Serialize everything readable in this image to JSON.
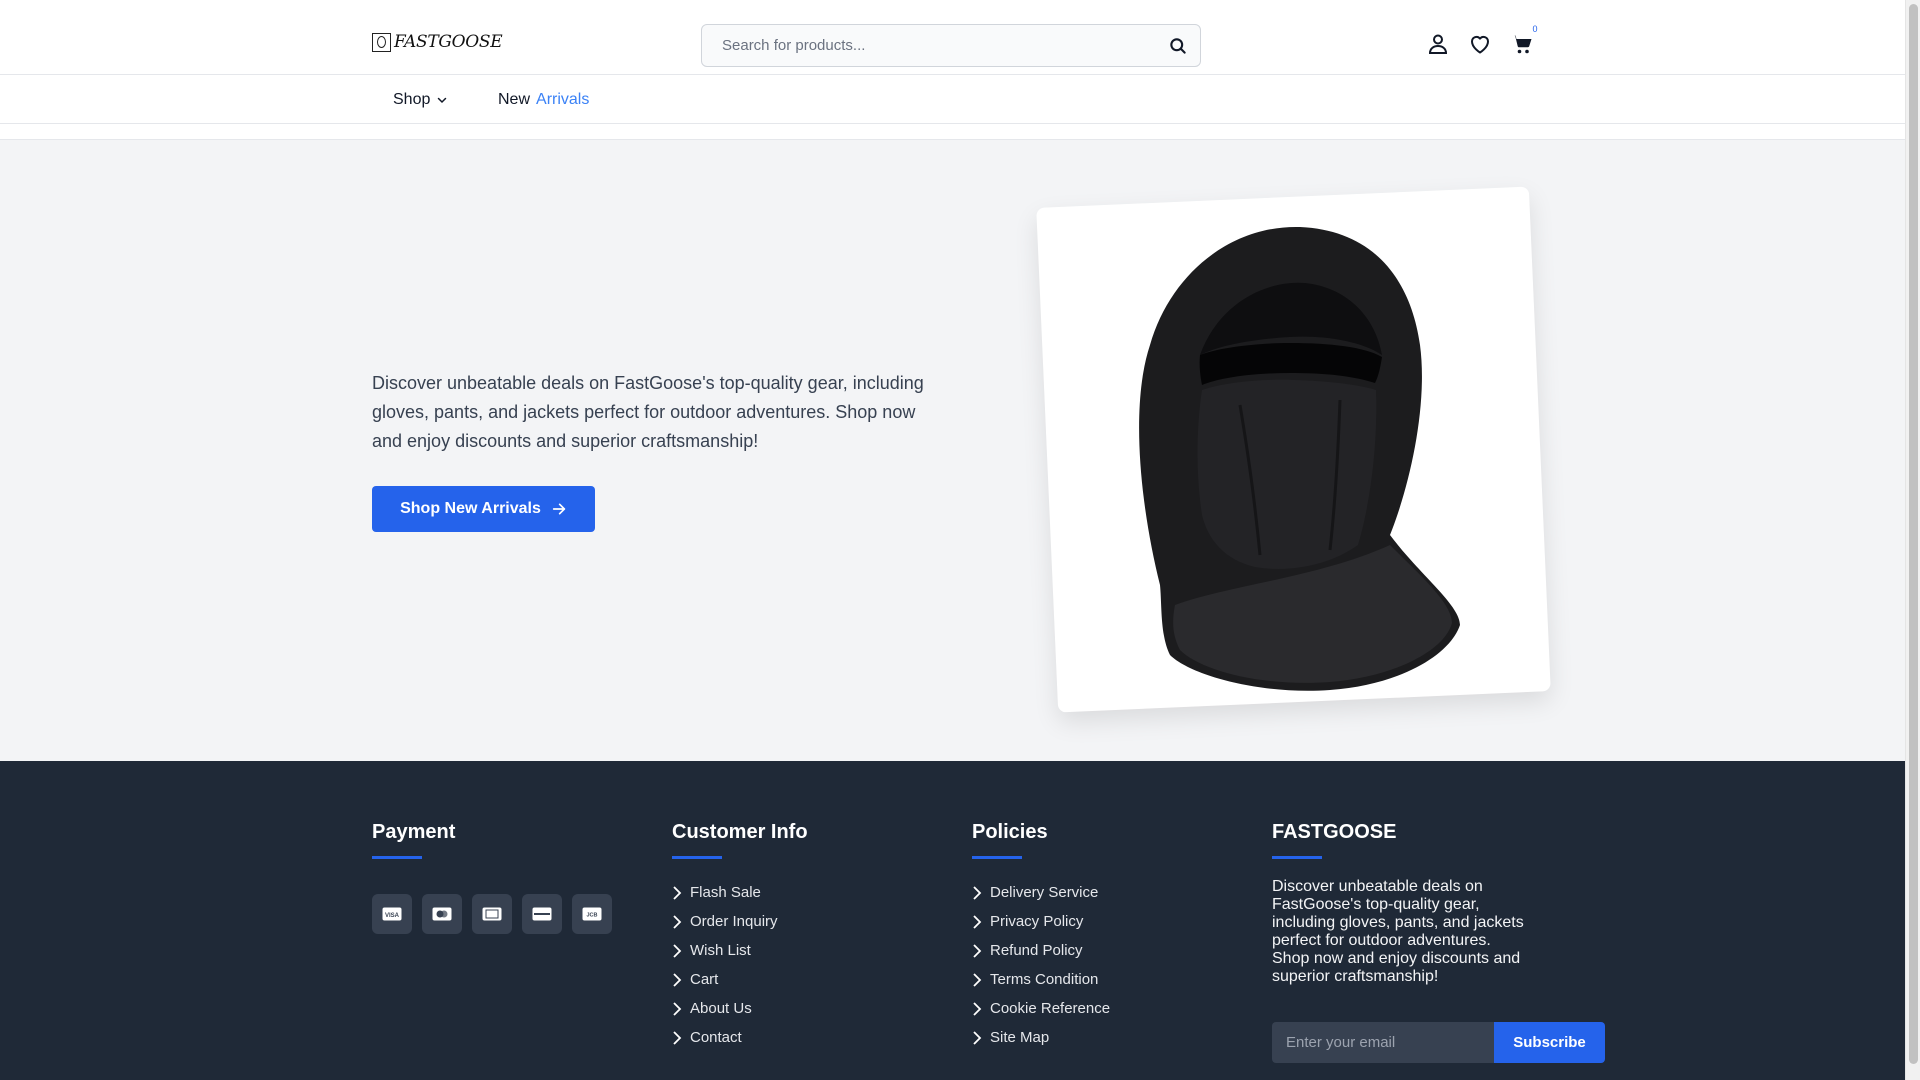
{
  "header": {
    "logo_text": "FASTGOOSE",
    "search_placeholder": "Search for products...",
    "cart_count": "0",
    "icons": [
      "user-icon",
      "heart-icon",
      "cart-icon",
      "search-icon"
    ]
  },
  "nav": {
    "shop_label": "Shop",
    "arrivals_word1": "New",
    "arrivals_word2": "Arrivals"
  },
  "hero": {
    "description": "Discover unbeatable deals on FastGoose's top-quality gear, including gloves, pants, and jackets perfect for outdoor adventures. Shop now and enjoy discounts and superior craftsmanship!",
    "cta_label": "Shop New Arrivals",
    "image_subject": "black fleece balaclava hood"
  },
  "footer": {
    "payment": {
      "title": "Payment",
      "methods": [
        "visa-icon",
        "mastercard-icon",
        "amex-icon",
        "discover-icon",
        "jcb-icon"
      ]
    },
    "customer_info": {
      "title": "Customer Info",
      "links": [
        "Flash Sale",
        "Order Inquiry",
        "Wish List",
        "Cart",
        "About Us",
        "Contact"
      ]
    },
    "policies": {
      "title": "Policies",
      "links": [
        "Delivery Service",
        "Privacy Policy",
        "Refund Policy",
        "Terms Condition",
        "Cookie Reference",
        "Site Map"
      ]
    },
    "brand": {
      "title": "FASTGOOSE",
      "description": "Discover unbeatable deals on FastGoose's top-quality gear, including gloves, pants, and jackets perfect for outdoor adventures. Shop now and enjoy discounts and superior craftsmanship!",
      "email_placeholder": "Enter your email",
      "subscribe_label": "Subscribe"
    }
  },
  "colors": {
    "accent": "#2563eb",
    "footer_bg": "#1f2937",
    "hero_bg": "#f3f4f6"
  }
}
